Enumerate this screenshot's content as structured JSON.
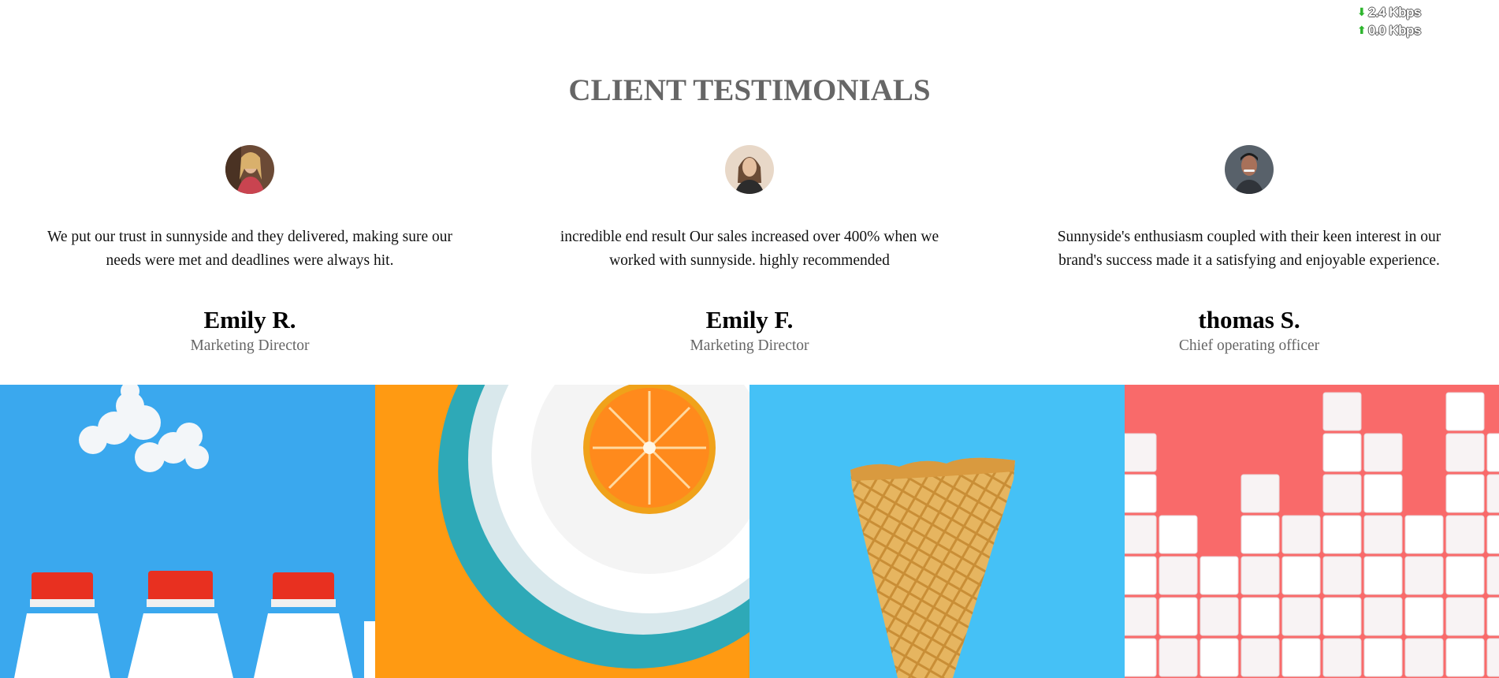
{
  "net_speed": {
    "down": "2.4 Kbps",
    "up": "0.0 Kbps",
    "down_icon": "arrow-down-icon",
    "up_icon": "arrow-up-icon",
    "arrow_color": "#2db52d"
  },
  "section": {
    "title": "CLIENT TESTIMONIALS"
  },
  "testimonials": [
    {
      "quote": "We put our trust in sunnyside and they delivered, making sure our needs were met and deadlines were always hit.",
      "name": "Emily R.",
      "role": "Marketing Director"
    },
    {
      "quote": "incredible end result Our sales increased over 400% when we worked with sunnyside. highly recommended",
      "name": "Emily F.",
      "role": "Marketing Director"
    },
    {
      "quote": "Sunnyside's enthusiasm coupled with their keen interest in our brand's success made it a satisfying and enjoyable experience.",
      "name": "thomas S.",
      "role": "Chief operating officer"
    }
  ],
  "gallery": [
    {
      "subject": "milk-bottles",
      "background": "#3aa8ee"
    },
    {
      "subject": "orange-on-plate",
      "background": "#ff9a12"
    },
    {
      "subject": "waffle-cone",
      "background": "#45c1f6"
    },
    {
      "subject": "sugar-cubes",
      "background": "#f96a6a"
    }
  ]
}
